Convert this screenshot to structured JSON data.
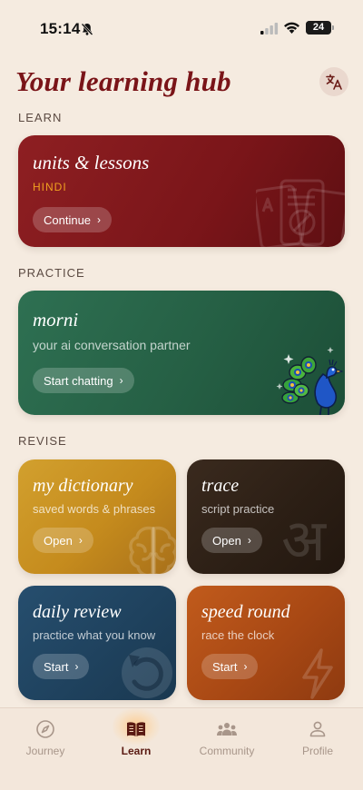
{
  "status_bar": {
    "time": "15:14",
    "battery": "24",
    "battery_level": 0.24
  },
  "header": {
    "title": "Your learning hub",
    "translate_icon": "translate-icon"
  },
  "sections": {
    "learn": "LEARN",
    "practice": "PRACTICE",
    "revise": "REVISE"
  },
  "lessons_card": {
    "title": "units & lessons",
    "language": "HINDI",
    "button": "Continue"
  },
  "chat_card": {
    "title": "morni",
    "subtitle": "your ai conversation partner",
    "button": "Start chatting"
  },
  "dictionary_card": {
    "title": "my dictionary",
    "subtitle": "saved words & phrases",
    "button": "Open"
  },
  "trace_card": {
    "title": "trace",
    "subtitle": "script practice",
    "button": "Open",
    "glyph": "अ"
  },
  "review_card": {
    "title": "daily review",
    "subtitle": "practice what you know",
    "button": "Start"
  },
  "speed_card": {
    "title": "speed round",
    "subtitle": "race the clock",
    "button": "Start"
  },
  "tabs": [
    {
      "label": "Journey",
      "icon": "compass-icon",
      "active": false
    },
    {
      "label": "Learn",
      "icon": "book-icon",
      "active": true
    },
    {
      "label": "Community",
      "icon": "people-icon",
      "active": false
    },
    {
      "label": "Profile",
      "icon": "person-icon",
      "active": false
    }
  ],
  "colors": {
    "background": "#f5ebe0",
    "title": "#7a1418",
    "learn": "#7a1519",
    "practice": "#255f44",
    "dictionary": "#c58b1d",
    "trace": "#2c1f15",
    "review": "#1f425e",
    "speed": "#a84814",
    "language_accent": "#f0a020"
  }
}
